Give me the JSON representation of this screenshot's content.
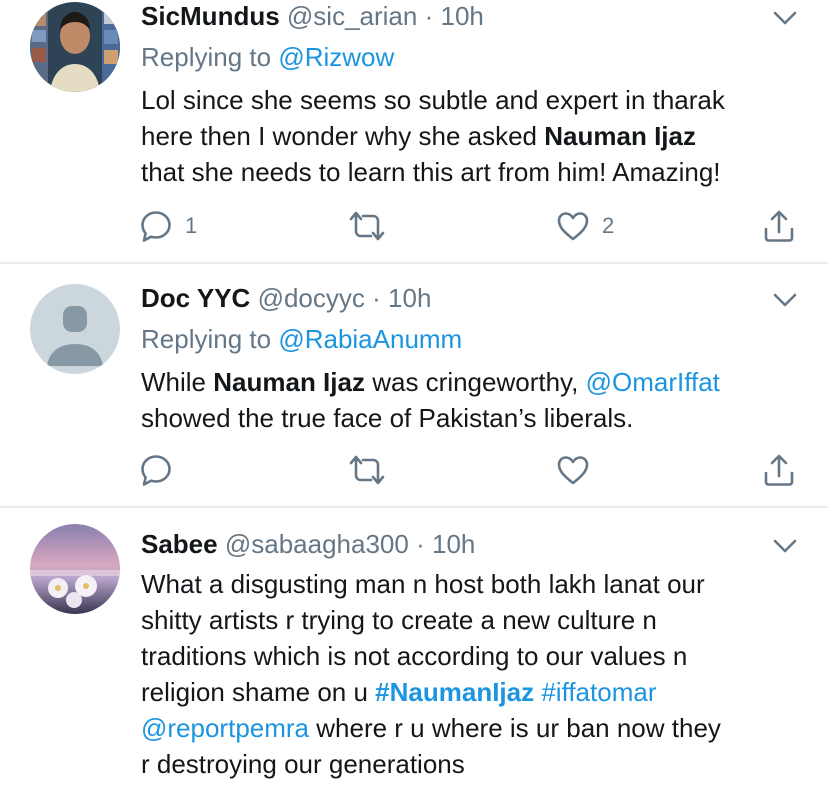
{
  "tweets": [
    {
      "name": "SicMundus",
      "handle": "@sic_arian",
      "dot": "·",
      "time": "10h",
      "replying_label": "Replying to",
      "replying_to": "@Rizwow",
      "text_line1": "Lol since she seems so subtle and expert in tharak",
      "text_line2_pre": "here then I wonder why she asked",
      "text_line2_bold": "Nauman Ijaz",
      "text_line3": "that she needs to learn this art from him! Amazing!",
      "reply_count": "1",
      "like_count": "2"
    },
    {
      "name": "Doc YYC",
      "handle": "@docyyc",
      "dot": "·",
      "time": "10h",
      "replying_label": "Replying to",
      "replying_to": "@RabiaAnumm",
      "text_line1_pre": "While",
      "text_line1_bold": "Nauman Ijaz",
      "text_line1_mid": "was cringeworthy,",
      "text_line1_mention": "@OmarIffat",
      "text_line2": "showed the true face of Pakistan’s liberals."
    },
    {
      "name": "Sabee",
      "handle": "@sabaagha300",
      "dot": "·",
      "time": "10h",
      "text_line1": "What a disgusting man n host both lakh lanat our",
      "text_line2": "shitty artists r trying to create a new culture n",
      "text_line3": "traditions which is not according to our values n",
      "text_line4_pre": "religion shame on u",
      "text_line4_hashtag_bold": "#NaumanIjaz",
      "text_line4_hashtag": "#iffatomar",
      "text_line5_mention": "@reportpemra",
      "text_line5_rest": "where r u where is ur ban now they",
      "text_line6": "r destroying our generations"
    }
  ],
  "icons": [
    "reply-icon",
    "retweet-icon",
    "like-icon",
    "share-icon",
    "chevron-down-icon"
  ],
  "colors": {
    "link": "#1b95e0",
    "secondary": "#657786",
    "text": "#14171a",
    "divider": "#e6ecf0"
  }
}
